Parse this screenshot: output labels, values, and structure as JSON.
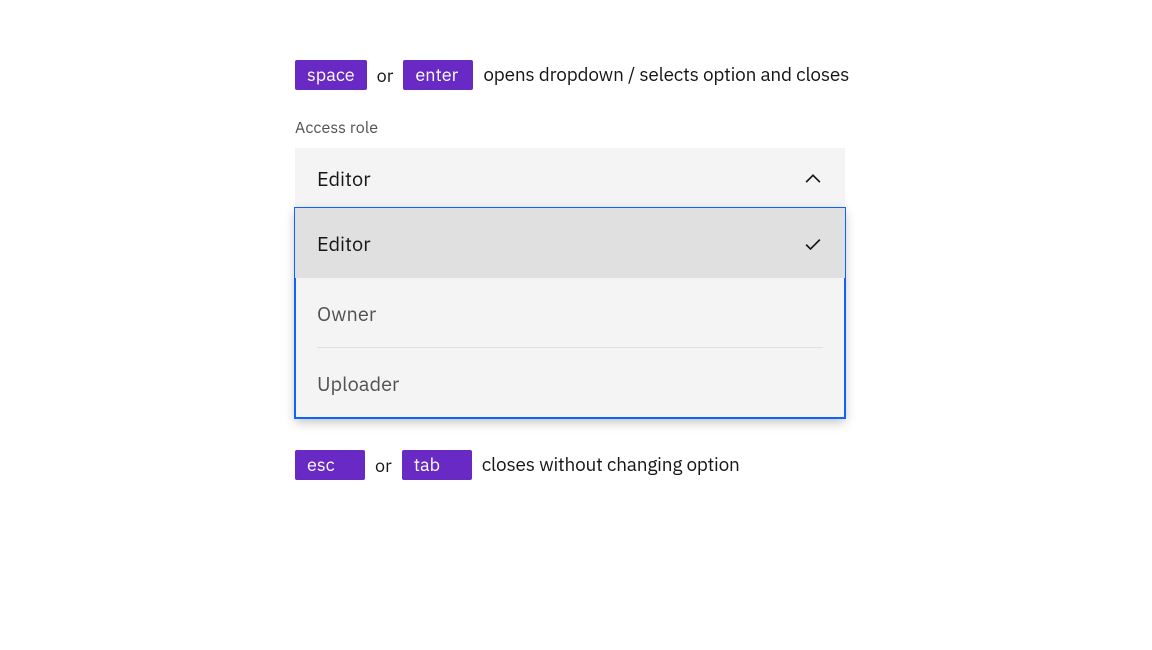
{
  "hints": {
    "top": {
      "key1": "space",
      "or": "or",
      "key2": "enter",
      "text": "opens dropdown / selects option and closes"
    },
    "bottom": {
      "key1": "esc",
      "or": "or",
      "key2": "tab",
      "text": "closes without changing option"
    }
  },
  "dropdown": {
    "label": "Access role",
    "selected": "Editor",
    "options": [
      {
        "label": "Editor",
        "selected": true
      },
      {
        "label": "Owner",
        "selected": false
      },
      {
        "label": "Uploader",
        "selected": false
      }
    ]
  },
  "colors": {
    "keyBadge": "#6929c4",
    "focusRing": "#0f62fe"
  }
}
